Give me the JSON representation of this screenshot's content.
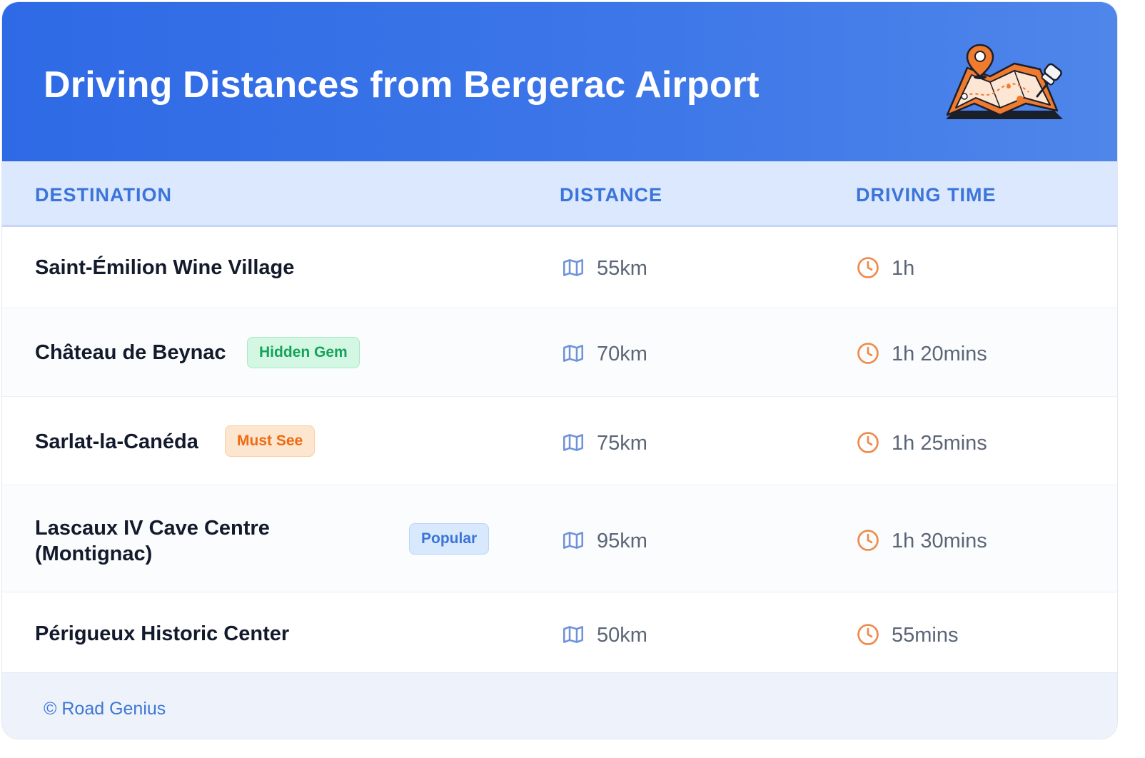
{
  "title": "Driving Distances from Bergerac Airport",
  "columns": {
    "destination": "DESTINATION",
    "distance": "DISTANCE",
    "time": "DRIVING TIME"
  },
  "rows": [
    {
      "destination": "Saint-Émilion Wine Village",
      "badge": "",
      "distance": "55km",
      "time": "1h"
    },
    {
      "destination": "Château de Beynac",
      "badge": "Hidden Gem",
      "distance": "70km",
      "time": "1h 20mins"
    },
    {
      "destination": "Sarlat-la-Canéda",
      "badge": "Must See",
      "distance": "75km",
      "time": "1h 25mins"
    },
    {
      "destination_line1": "Lascaux IV Cave Centre",
      "destination_line2": "(Montignac)",
      "badge": "Popular",
      "distance": "95km",
      "time": "1h 30mins"
    },
    {
      "destination": "Périgueux Historic Center",
      "badge": "",
      "distance": "50km",
      "time": "55mins"
    }
  ],
  "footer": {
    "copyright": "© Road Genius"
  },
  "icons": {
    "distance": "map-icon",
    "time": "clock-icon",
    "header": "map-pin-illustration"
  },
  "colors": {
    "header_blue": "#2f6ae6",
    "accent_blue": "#3b74da",
    "icon_orange": "#ef8a4c",
    "badge_green": "#13a35a",
    "badge_orange": "#ef6b12"
  }
}
